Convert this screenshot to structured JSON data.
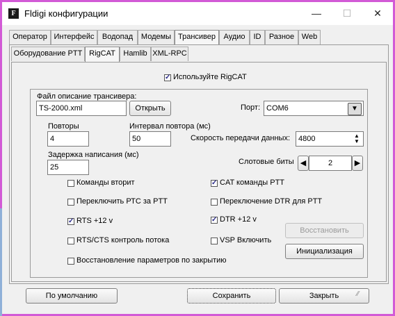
{
  "window": {
    "title": "Fldigi конфигурации",
    "min": "—",
    "max": "☐",
    "close": "✕"
  },
  "tabs": [
    "Оператор",
    "Интерфейс",
    "Водопад",
    "Модемы",
    "Трансивер",
    "Аудио",
    "ID",
    "Разное",
    "Web"
  ],
  "subtabs": [
    "Оборудование PTT",
    "RigCAT",
    "Hamlib",
    "XML-RPC"
  ],
  "rigcat": {
    "use_label": "Используйте RigCAT",
    "use_checked": true,
    "file_label": "Файл описание трансивера:",
    "file_value": "TS-2000.xml",
    "open_label": "Открыть",
    "port_label": "Порт:",
    "port_value": "COM6",
    "retries_label": "Повторы",
    "retries_value": "4",
    "interval_label": "Интервал повтора (мс)",
    "interval_value": "50",
    "baud_label": "Скорость передачи данных:",
    "baud_value": "4800",
    "delay_label": "Задержка написания (мс)",
    "delay_value": "25",
    "stopbits_label": "Слотовые биты",
    "stopbits_value": "2",
    "checks": {
      "echo": {
        "label": "Команды вторит",
        "checked": false
      },
      "cat_ptt": {
        "label": "CAT команды PTT",
        "checked": true
      },
      "rts_ptt": {
        "label": "Переключить РТС за PTT",
        "checked": false
      },
      "dtr_ptt": {
        "label": "Переключение DTR для PTT",
        "checked": false
      },
      "rts12": {
        "label": "RTS +12 v",
        "checked": true
      },
      "dtr12": {
        "label": "DTR +12 v",
        "checked": true
      },
      "rtscts": {
        "label": "RTS/CTS контроль потока",
        "checked": false
      },
      "vsp": {
        "label": "VSP Включить",
        "checked": false
      },
      "restore": {
        "label": "Восстановление параметров по закрытию",
        "checked": false
      }
    },
    "restore_btn": "Восстановить",
    "init_btn": "Инициализация"
  },
  "footer": {
    "defaults": "По умолчанию",
    "save": "Сохранить",
    "close": "Закрыть"
  },
  "colors": {
    "frame": "#d25ad6",
    "desktop": "#8fb0d8"
  }
}
